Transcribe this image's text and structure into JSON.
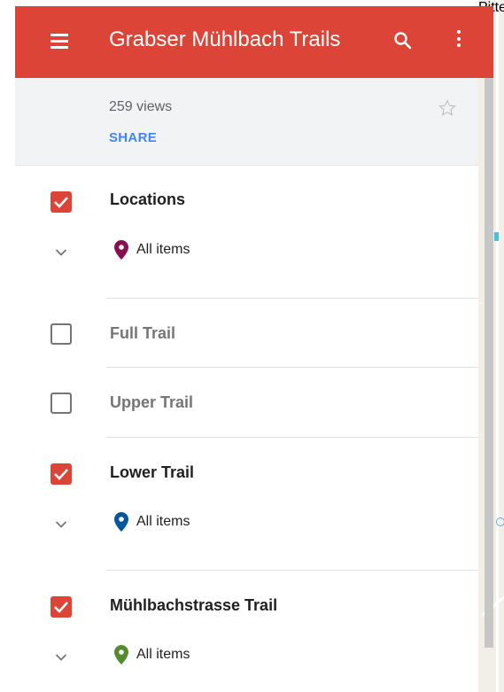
{
  "app": {
    "title": "Grabser Mühlbach Trails",
    "menu_icon": "hamburger-menu-icon",
    "search_icon": "search-icon",
    "more_icon": "more-vert-icon",
    "header_color": "#db4437"
  },
  "info": {
    "views": "259 views",
    "share_label": "SHARE",
    "star_icon": "star-outline-icon"
  },
  "layers": [
    {
      "title": "Locations",
      "checked": true,
      "items_label": "All items",
      "marker_color": "#880e4f"
    },
    {
      "title": "Full Trail",
      "checked": false
    },
    {
      "title": "Upper Trail",
      "checked": false
    },
    {
      "title": "Lower Trail",
      "checked": true,
      "items_label": "All items",
      "marker_color": "#01579b"
    },
    {
      "title": "Mühlbachstrasse Trail",
      "checked": true,
      "items_label": "All items",
      "marker_color": "#558b2f"
    }
  ],
  "map": {
    "edge_label": "Pittelis"
  },
  "colors": {
    "accent": "#db4437",
    "share": "#4285f4"
  }
}
